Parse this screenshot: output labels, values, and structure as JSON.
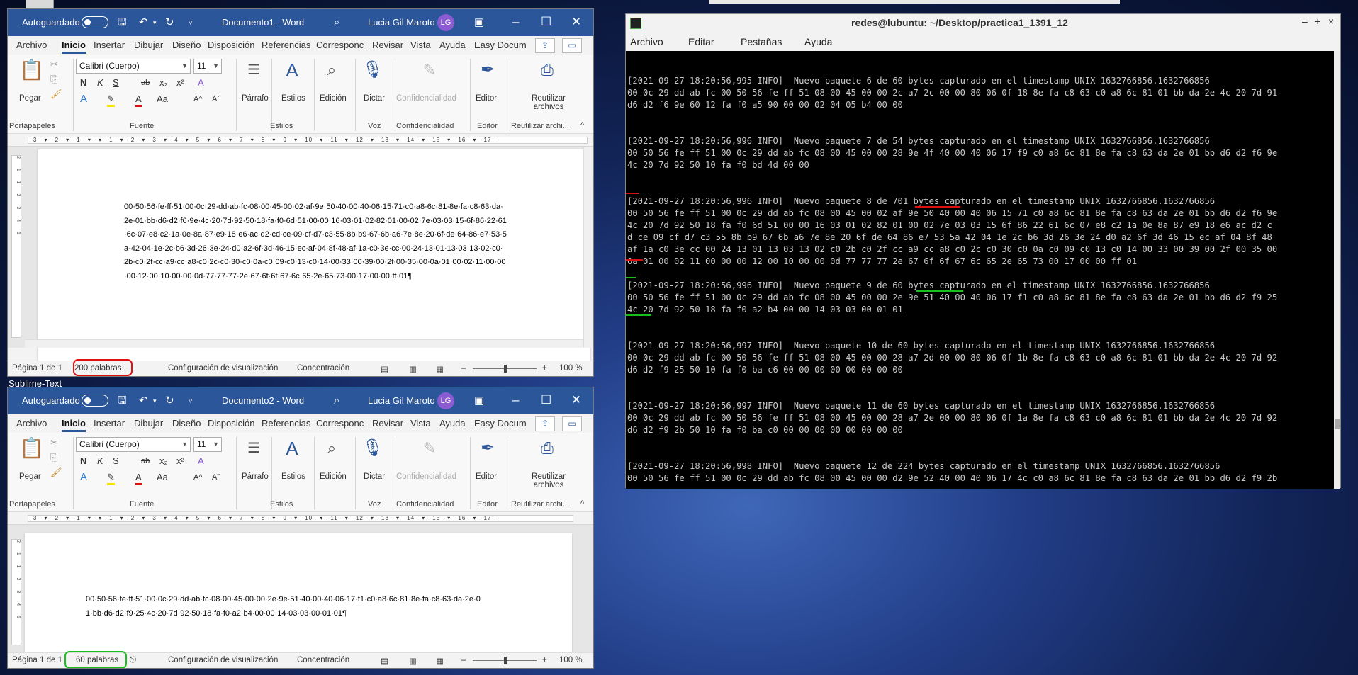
{
  "desktop": {
    "label": "Sublime-Text"
  },
  "ribbon_shared": {
    "tabs": [
      "Archivo",
      "Inicio",
      "Insertar",
      "Dibujar",
      "Diseño",
      "Disposición",
      "Referencias",
      "Corresponc",
      "Revisar",
      "Vista",
      "Ayuda",
      "Easy Docum"
    ],
    "font_name": "Calibri (Cuerpo)",
    "font_size": "11",
    "paste": "Pegar",
    "paragraph": "Párrafo",
    "styles": "Estilos",
    "editing": "Edición",
    "dictate": "Dictar",
    "confidentiality": "Confidencialidad",
    "editor": "Editor",
    "reuse": "Reutilizar archivos",
    "group_clipboard": "Portapapeles",
    "group_font": "Fuente",
    "group_styles": "Estilos",
    "group_voice": "Voz",
    "group_conf": "Confidencialidad",
    "group_editor": "Editor",
    "group_reuse": "Reutilizar archi...",
    "font_buttons": {
      "bold": "N",
      "italic": "K",
      "underline": "S",
      "strike": "ab",
      "sub": "x₂",
      "sup": "x²",
      "clear": "A",
      "effects": "A",
      "highlight": "✎",
      "color": "A",
      "case": "Aa",
      "grow": "A^",
      "shrink": "Aˇ"
    },
    "ruler_numbers": "· 3 · ▾ · 2 · ▾ · 1 · ▾ · ▾ · 1 · ▾ · 2 · ▾ · 3 · ▾ · 4 · ▾ · 5 · ▾ · 6 · ▾ · 7 · ▾ · 8 · ▾ · 9 · ▾ · 10 · ▾ · 11 · ▾ · 12 · ▾ · 13 · ▾ · 14 · ▾ · 15 · ▾ · 16 · ▾ · 17 ·",
    "vruler_numbers": "2 1 1 2 3 4 5"
  },
  "word1": {
    "autosave": "Autoguardado",
    "title": "Documento1  -  Word",
    "user": "Lucia Gil Maroto",
    "initials": "LG",
    "doc_text": "00·50·56·fe·ff·51·00·0c·29·dd·ab·fc·08·00·45·00·02·af·9e·50·40·00·40·06·15·71·c0·a8·6c·81·8e·fa·c8·63·da·2e·01·bb·d6·d2·f6·9e·4c·20·7d·92·50·18·fa·f0·6d·51·00·00·16·03·01·02·82·01·00·02·7e·03·03·15·6f·86·22·61·6c·07·e8·c2·1a·0e·8a·87·e9·18·e6·ac·d2·cd·ce·09·cf·d7·c3·55·8b·b9·67·6b·a6·7e·8e·20·6f·de·64·86·e7·53·5a·42·04·1e·2c·b6·3d·26·3e·24·d0·a2·6f·3d·46·15·ec·af·04·8f·48·af·1a·c0·3e·cc·00·24·13·01·13·03·13·02·c0·2b·c0·2f·cc·a9·cc·a8·c0·2c·c0·30·c0·0a·c0·09·c0·13·c0·14·00·33·00·39·00·2f·00·35·00·0a·01·00·02·11·00·00·00·12·00·10·00·00·0d·77·77·77·2e·67·6f·6f·67·6c·65·2e·65·73·00·17·00·00·ff·01¶",
    "page_info": "Página 1 de 1",
    "word_count": "200 palabras",
    "display_settings": "Configuración de visualización",
    "focus": "Concentración",
    "zoom": "100 %"
  },
  "word2": {
    "autosave": "Autoguardado",
    "title": "Documento2  -  Word",
    "user": "Lucia Gil Maroto",
    "initials": "LG",
    "doc_text": "00·50·56·fe·ff·51·00·0c·29·dd·ab·fc·08·00·45·00·00·2e·9e·51·40·00·40·06·17·f1·c0·a8·6c·81·8e·fa·c8·63·da·2e·01·bb·d6·d2·f9·25·4c·20·7d·92·50·18·fa·f0·a2·b4·00·00·14·03·03·00·01·01¶",
    "page_info": "Página 1 de 1",
    "word_count": "60 palabras",
    "display_settings": "Configuración de visualización",
    "focus": "Concentración",
    "zoom": "100 %"
  },
  "terminal": {
    "title": "redes@lubuntu: ~/Desktop/practica1_1391_12",
    "menu": [
      "Archivo",
      "Editar",
      "Pestañas",
      "Ayuda"
    ],
    "controls": {
      "min": "–",
      "max": "+",
      "close": "×"
    },
    "entries": [
      {
        "header": "[2021-09-27 18:20:56,995 INFO]  Nuevo paquete 6 de 60 bytes capturado en el timestamp UNIX 1632766856.1632766856",
        "lines": [
          "00 0c 29 dd ab fc 00 50 56 fe ff 51 08 00 45 00 00 2c a7 2c 00 00 80 06 0f 18 8e fa c8 63 c0 a8 6c 81 01 bb da 2e 4c 20 7d 91",
          "d6 d2 f6 9e 60 12 fa f0 a5 90 00 00 02 04 05 b4 00 00"
        ]
      },
      {
        "header": "[2021-09-27 18:20:56,996 INFO]  Nuevo paquete 7 de 54 bytes capturado en el timestamp UNIX 1632766856.1632766856",
        "lines": [
          "00 50 56 fe ff 51 00 0c 29 dd ab fc 08 00 45 00 00 28 9e 4f 40 00 40 06 17 f9 c0 a8 6c 81 8e fa c8 63 da 2e 01 bb d6 d2 f6 9e",
          "4c 20 7d 92 50 10 fa f0 bd 4d 00 00"
        ]
      },
      {
        "header": "[2021-09-27 18:20:56,996 INFO]  Nuevo paquete 8 de 701 bytes capturado en el timestamp UNIX 1632766856.1632766856",
        "lines": [
          "00 50 56 fe ff 51 00 0c 29 dd ab fc 08 00 45 00 02 af 9e 50 40 00 40 06 15 71 c0 a8 6c 81 8e fa c8 63 da 2e 01 bb d6 d2 f6 9e",
          "4c 20 7d 92 50 18 fa f0 6d 51 00 00 16 03 01 02 82 01 00 02 7e 03 03 15 6f 86 22 61 6c 07 e8 c2 1a 0e 8a 87 e9 18 e6 ac d2 c",
          "d ce 09 cf d7 c3 55 8b b9 67 6b a6 7e 8e 20 6f de 64 86 e7 53 5a 42 04 1e 2c b6 3d 26 3e 24 d0 a2 6f 3d 46 15 ec af 04 8f 48",
          "af 1a c0 3e cc 00 24 13 01 13 03 13 02 c0 2b c0 2f cc a9 cc a8 c0 2c c0 30 c0 0a c0 09 c0 13 c0 14 00 33 00 39 00 2f 00 35 00",
          "0a 01 00 02 11 00 00 00 12 00 10 00 00 0d 77 77 77 2e 67 6f 6f 67 6c 65 2e 65 73 00 17 00 00 ff 01"
        ]
      },
      {
        "header": "[2021-09-27 18:20:56,996 INFO]  Nuevo paquete 9 de 60 bytes capturado en el timestamp UNIX 1632766856.1632766856",
        "lines": [
          "00 50 56 fe ff 51 00 0c 29 dd ab fc 08 00 45 00 00 2e 9e 51 40 00 40 06 17 f1 c0 a8 6c 81 8e fa c8 63 da 2e 01 bb d6 d2 f9 25",
          "4c 20 7d 92 50 18 fa f0 a2 b4 00 00 14 03 03 00 01 01"
        ]
      },
      {
        "header": "[2021-09-27 18:20:56,997 INFO]  Nuevo paquete 10 de 60 bytes capturado en el timestamp UNIX 1632766856.1632766856",
        "lines": [
          "00 0c 29 dd ab fc 00 50 56 fe ff 51 08 00 45 00 00 28 a7 2d 00 00 80 06 0f 1b 8e fa c8 63 c0 a8 6c 81 01 bb da 2e 4c 20 7d 92",
          "d6 d2 f9 25 50 10 fa f0 ba c6 00 00 00 00 00 00 00 00"
        ]
      },
      {
        "header": "[2021-09-27 18:20:56,997 INFO]  Nuevo paquete 11 de 60 bytes capturado en el timestamp UNIX 1632766856.1632766856",
        "lines": [
          "00 0c 29 dd ab fc 00 50 56 fe ff 51 08 00 45 00 00 28 a7 2e 00 00 80 06 0f 1a 8e fa c8 63 c0 a8 6c 81 01 bb da 2e 4c 20 7d 92",
          "d6 d2 f9 2b 50 10 fa f0 ba c0 00 00 00 00 00 00 00 00"
        ]
      },
      {
        "header": "[2021-09-27 18:20:56,998 INFO]  Nuevo paquete 12 de 224 bytes capturado en el timestamp UNIX 1632766856.1632766856",
        "lines": [
          "00 50 56 fe ff 51 00 0c 29 dd ab fc 08 00 45 00 00 d2 9e 52 40 00 40 06 17 4c c0 a8 6c 81 8e fa c8 63 da 2e 01 bb d6 d2 f9 2b"
        ]
      }
    ]
  },
  "colors": {
    "word_blue": "#2b579a",
    "annotation_red": "#e01010",
    "annotation_green": "#18c01c",
    "terminal_bg": "#000000"
  }
}
